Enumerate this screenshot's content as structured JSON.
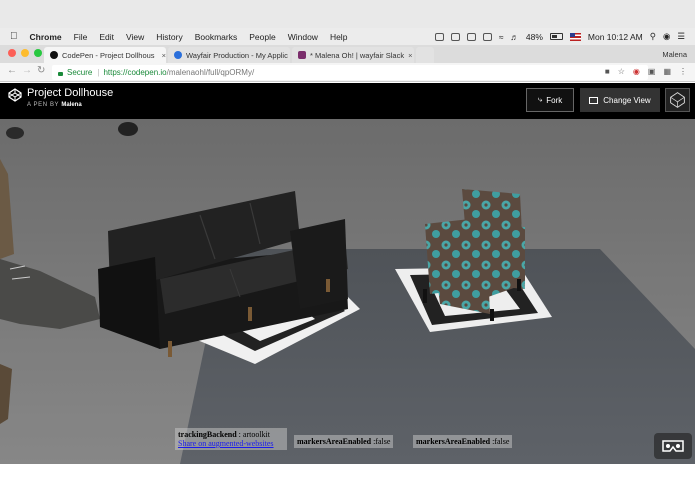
{
  "os_menu": {
    "app": "Chrome",
    "items": [
      "File",
      "Edit",
      "View",
      "History",
      "Bookmarks",
      "People",
      "Window",
      "Help"
    ],
    "battery": "48%",
    "clock": "Mon 10:12 AM"
  },
  "browser": {
    "tabs": [
      {
        "title": "CodePen - Project Dollhous",
        "active": true
      },
      {
        "title": "Wayfair Production - My Applic",
        "active": false
      },
      {
        "title": "* Malena Oh! | wayfair Slack",
        "active": false
      }
    ],
    "profile": "Malena",
    "secure_label": "Secure",
    "url_host": "https://codepen.io",
    "url_path": "/malenaohl/full/qpORMy/"
  },
  "codepen": {
    "title": "Project Dollhouse",
    "pen_by": "A PEN BY",
    "author": "Malena",
    "fork_label": "Fork",
    "change_view_label": "Change View"
  },
  "overlay": {
    "tracking_label": "trackingBackend",
    "tracking_value": " : artoolkit",
    "share_link": "Share on augmented-websites",
    "markers_label_1": "markersAreaEnabled",
    "markers_value_1": " :false",
    "markers_label_2": "markersAreaEnabled",
    "markers_value_2": " :false"
  },
  "icons": {
    "vr": "vr-headset-icon",
    "codepen": "codepen-logo-icon"
  }
}
